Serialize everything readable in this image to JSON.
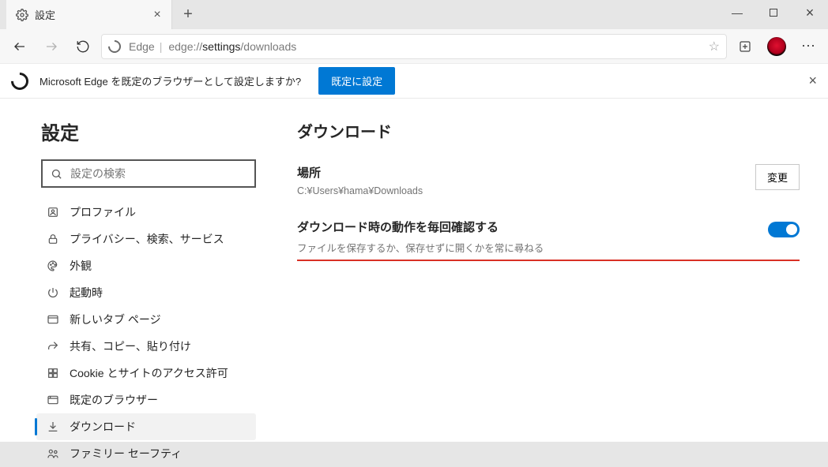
{
  "tab": {
    "title": "設定"
  },
  "addr": {
    "edge_label": "Edge",
    "prefix": "edge://",
    "path_bold": "settings",
    "path_rest": "/downloads"
  },
  "prompt": {
    "text": "Microsoft Edge を既定のブラウザーとして設定しますか?",
    "button": "既定に設定"
  },
  "sidebar": {
    "title": "設定",
    "search_placeholder": "設定の検索",
    "items": [
      {
        "label": "プロファイル"
      },
      {
        "label": "プライバシー、検索、サービス"
      },
      {
        "label": "外観"
      },
      {
        "label": "起動時"
      },
      {
        "label": "新しいタブ ページ"
      },
      {
        "label": "共有、コピー、貼り付け"
      },
      {
        "label": "Cookie とサイトのアクセス許可"
      },
      {
        "label": "既定のブラウザー"
      },
      {
        "label": "ダウンロード"
      },
      {
        "label": "ファミリー セーフティ"
      }
    ]
  },
  "main": {
    "title": "ダウンロード",
    "location_label": "場所",
    "location_path": "C:¥Users¥hama¥Downloads",
    "change_button": "変更",
    "ask_label": "ダウンロード時の動作を毎回確認する",
    "ask_desc": "ファイルを保存するか、保存せずに開くかを常に尋ねる"
  }
}
